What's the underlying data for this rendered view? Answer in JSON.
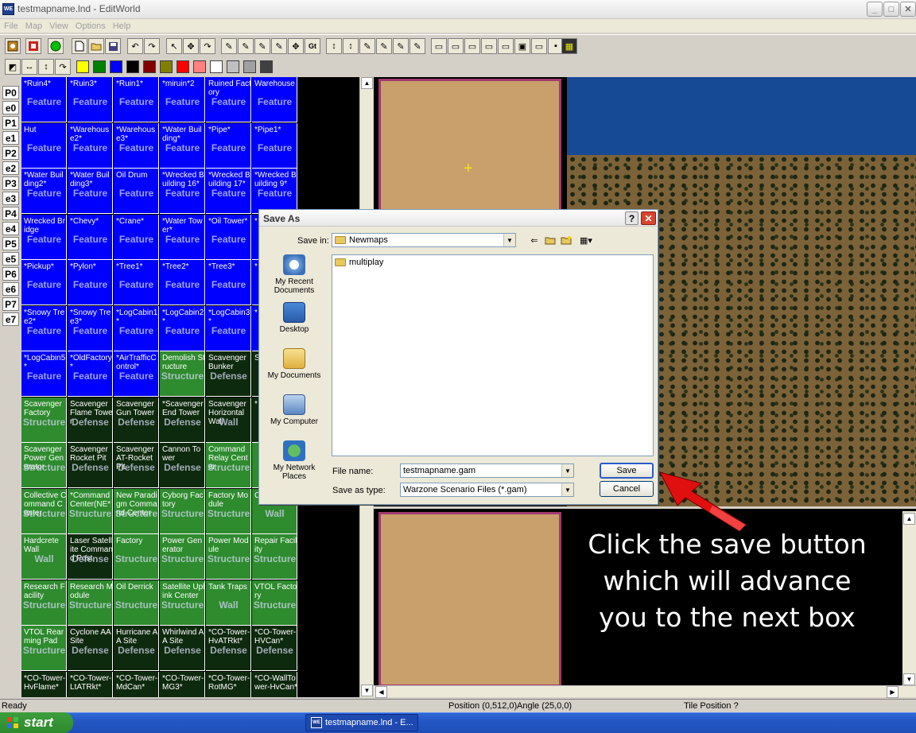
{
  "window": {
    "app_icon": "WE",
    "title": "testmapname.lnd - EditWorld",
    "min": "_",
    "max": "□",
    "close": "✕"
  },
  "menu": [
    "File",
    "Map",
    "View",
    "Options",
    "Help"
  ],
  "toolbar2_colors": [
    "#ffff00",
    "#008000",
    "#0000ff",
    "#000000",
    "#800000",
    "#808000",
    "#ff0000",
    "#ff8080",
    "#ffffff",
    "#c0c0c0",
    "#a0a0a0",
    "#404040"
  ],
  "player_tabs": [
    "P0",
    "e0",
    "P1",
    "e1",
    "P2",
    "e2",
    "P3",
    "e3",
    "P4",
    "e4",
    "P5",
    "e5",
    "P6",
    "e6",
    "P7",
    "e7"
  ],
  "feature_grid": [
    [
      {
        "n": "*Ruin4*",
        "t": "Feature",
        "c": "blue"
      },
      {
        "n": "*Ruin3*",
        "t": "Feature",
        "c": "blue"
      },
      {
        "n": "*Ruin1*",
        "t": "Feature",
        "c": "blue"
      },
      {
        "n": "*miruin*2",
        "t": "Feature",
        "c": "blue"
      },
      {
        "n": "Ruined Factory",
        "t": "Feature",
        "c": "blue"
      },
      {
        "n": "Warehouse",
        "t": "Feature",
        "c": "blue"
      }
    ],
    [
      {
        "n": "Hut",
        "t": "Feature",
        "c": "blue"
      },
      {
        "n": "*Warehouse2*",
        "t": "Feature",
        "c": "blue"
      },
      {
        "n": "*Warehouse3*",
        "t": "Feature",
        "c": "blue"
      },
      {
        "n": "*Water Building*",
        "t": "Feature",
        "c": "blue"
      },
      {
        "n": "*Pipe*",
        "t": "Feature",
        "c": "blue"
      },
      {
        "n": "*Pipe1*",
        "t": "Feature",
        "c": "blue"
      }
    ],
    [
      {
        "n": "*Water Building2*",
        "t": "Feature",
        "c": "blue"
      },
      {
        "n": "*Water Building3*",
        "t": "Feature",
        "c": "blue"
      },
      {
        "n": "Oil Drum",
        "t": "Feature",
        "c": "blue"
      },
      {
        "n": "*Wrecked Building 16*",
        "t": "Feature",
        "c": "blue"
      },
      {
        "n": "*Wrecked Building 17*",
        "t": "Feature",
        "c": "blue"
      },
      {
        "n": "*Wrecked Building 9*",
        "t": "Feature",
        "c": "blue"
      }
    ],
    [
      {
        "n": "Wrecked Bridge",
        "t": "Feature",
        "c": "blue"
      },
      {
        "n": "*Chevy*",
        "t": "Feature",
        "c": "blue"
      },
      {
        "n": "*Crane*",
        "t": "Feature",
        "c": "blue"
      },
      {
        "n": "*Water Tower*",
        "t": "Feature",
        "c": "blue"
      },
      {
        "n": "*Oil Tower*",
        "t": "Feature",
        "c": "blue"
      },
      {
        "n": "*",
        "t": "",
        "c": "blue"
      }
    ],
    [
      {
        "n": "*Pickup*",
        "t": "Feature",
        "c": "blue"
      },
      {
        "n": "*Pylon*",
        "t": "Feature",
        "c": "blue"
      },
      {
        "n": "*Tree1*",
        "t": "Feature",
        "c": "blue"
      },
      {
        "n": "*Tree2*",
        "t": "Feature",
        "c": "blue"
      },
      {
        "n": "*Tree3*",
        "t": "Feature",
        "c": "blue"
      },
      {
        "n": "*",
        "t": "",
        "c": "blue"
      }
    ],
    [
      {
        "n": "*Snowy Tree2*",
        "t": "Feature",
        "c": "blue"
      },
      {
        "n": "*Snowy Tree3*",
        "t": "Feature",
        "c": "blue"
      },
      {
        "n": "*LogCabin1*",
        "t": "Feature",
        "c": "blue"
      },
      {
        "n": "*LogCabin2*",
        "t": "Feature",
        "c": "blue"
      },
      {
        "n": "*LogCabin3*",
        "t": "Feature",
        "c": "blue"
      },
      {
        "n": "*",
        "t": "",
        "c": "blue"
      }
    ],
    [
      {
        "n": "*LogCabin5*",
        "t": "Feature",
        "c": "blue"
      },
      {
        "n": "*OldFactory*",
        "t": "Feature",
        "c": "blue"
      },
      {
        "n": "*AirTrafficControl*",
        "t": "Feature",
        "c": "blue"
      },
      {
        "n": "Demolish Structure",
        "t": "Structure",
        "c": "green"
      },
      {
        "n": "Scavenger Bunker",
        "t": "Defense",
        "c": "dark"
      },
      {
        "n": "S",
        "t": "",
        "c": "dark"
      }
    ],
    [
      {
        "n": "Scavenger Factory",
        "t": "Structure",
        "c": "green"
      },
      {
        "n": "Scavenger Flame Tower",
        "t": "Defense",
        "c": "dark"
      },
      {
        "n": "Scavenger Gun Tower",
        "t": "Defense",
        "c": "dark"
      },
      {
        "n": "*Scavenger End Tower",
        "t": "Defense",
        "c": "dark"
      },
      {
        "n": "Scavenger Horizontal Wall",
        "t": "Wall",
        "c": "dark"
      },
      {
        "n": "*",
        "t": "",
        "c": "dark"
      }
    ],
    [
      {
        "n": "Scavenger Power Generator",
        "t": "Structure",
        "c": "green"
      },
      {
        "n": "Scavenger Rocket Pit",
        "t": "Defense",
        "c": "dark"
      },
      {
        "n": "Scavenger AT-Rocket Pit",
        "t": "Defense",
        "c": "dark"
      },
      {
        "n": "Cannon Tower",
        "t": "Defense",
        "c": "dark"
      },
      {
        "n": "Command Relay Center",
        "t": "Structure",
        "c": "green"
      },
      {
        "n": "",
        "t": "",
        "c": "green"
      }
    ],
    [
      {
        "n": "Collective Command Center",
        "t": "Structure",
        "c": "green"
      },
      {
        "n": "*Command Center(NE*",
        "t": "Structure",
        "c": "green"
      },
      {
        "n": "New Paradigm Command Center",
        "t": "Structure",
        "c": "green"
      },
      {
        "n": "Cyborg Factory",
        "t": "Structure",
        "c": "green"
      },
      {
        "n": "Factory Module",
        "t": "Structure",
        "c": "green"
      },
      {
        "n": "Corner Wall",
        "t": "Wall",
        "c": "green"
      }
    ],
    [
      {
        "n": "Hardcrete Wall",
        "t": "Wall",
        "c": "green"
      },
      {
        "n": "Laser Satellite Command Post",
        "t": "Defense",
        "c": "dark"
      },
      {
        "n": "Factory",
        "t": "Structure",
        "c": "green"
      },
      {
        "n": "Power Generator",
        "t": "Structure",
        "c": "green"
      },
      {
        "n": "Power Module",
        "t": "Structure",
        "c": "green"
      },
      {
        "n": "Repair Facility",
        "t": "Structure",
        "c": "green"
      }
    ],
    [
      {
        "n": "Research Facility",
        "t": "Structure",
        "c": "green"
      },
      {
        "n": "Research Module",
        "t": "Structure",
        "c": "green"
      },
      {
        "n": "Oil Derrick",
        "t": "Structure",
        "c": "green"
      },
      {
        "n": "Satellite Uplink Center",
        "t": "Structure",
        "c": "green"
      },
      {
        "n": "Tank Traps",
        "t": "Wall",
        "c": "green"
      },
      {
        "n": "VTOL Factory",
        "t": "Structure",
        "c": "green"
      }
    ],
    [
      {
        "n": "VTOL Rearming Pad",
        "t": "Structure",
        "c": "green"
      },
      {
        "n": "Cyclone AA Site",
        "t": "Defense",
        "c": "dark"
      },
      {
        "n": "Hurricane AA Site",
        "t": "Defense",
        "c": "dark"
      },
      {
        "n": "Whirlwind AA Site",
        "t": "Defense",
        "c": "dark"
      },
      {
        "n": "*CO-Tower-HvATRkt*",
        "t": "Defense",
        "c": "dark"
      },
      {
        "n": "*CO-Tower-HVCan*",
        "t": "Defense",
        "c": "dark"
      }
    ],
    [
      {
        "n": "*CO-Tower-HvFlame*",
        "t": "",
        "c": "dark"
      },
      {
        "n": "*CO-Tower-LtATRkt*",
        "t": "",
        "c": "dark"
      },
      {
        "n": "*CO-Tower-MdCan*",
        "t": "",
        "c": "dark"
      },
      {
        "n": "*CO-Tower-MG3*",
        "t": "",
        "c": "dark"
      },
      {
        "n": "*CO-Tower-RotMG*",
        "t": "",
        "c": "dark"
      },
      {
        "n": "*CO-WallTower-HvCan*",
        "t": "",
        "c": "dark"
      }
    ]
  ],
  "instruction": {
    "line1": "Click the save button",
    "line2": "which will advance",
    "line3": "you to the next box"
  },
  "dialog": {
    "title": "Save As",
    "help": "?",
    "close": "✕",
    "save_in_label": "Save in:",
    "save_in_value": "Newmaps",
    "places": [
      "My Recent Documents",
      "Desktop",
      "My Documents",
      "My Computer",
      "My Network Places"
    ],
    "files": [
      "multiplay"
    ],
    "file_name_label": "File name:",
    "file_name_value": "testmapname.gam",
    "save_type_label": "Save as type:",
    "save_type_value": "Warzone Scenario Files (*.gam)",
    "save_button": "Save",
    "cancel_button": "Cancel"
  },
  "status": {
    "ready": "Ready",
    "position": "Position (0,512,0)",
    "angle": "Angle (25,0,0)",
    "tile_position": "Tile Position ?"
  },
  "taskbar": {
    "start": "start",
    "task_icon": "WE",
    "task": "testmapname.lnd - E..."
  }
}
